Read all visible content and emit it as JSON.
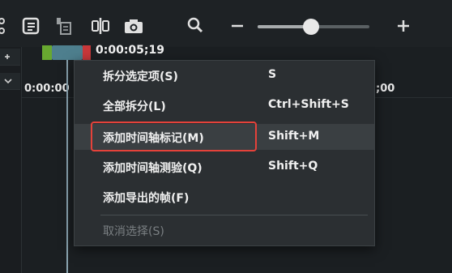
{
  "toolbar": {
    "icons": [
      "scissors-icon",
      "notes-icon",
      "paste-icon",
      "split-icon",
      "camera-icon",
      "search-icon",
      "zoom-out-icon",
      "zoom-slider",
      "zoom-in-icon"
    ],
    "zoom_level": 0.55
  },
  "timeline": {
    "playhead_time": "0:00:05;19",
    "ruler_left": "0:00:00",
    "ruler_right": ";00"
  },
  "context_menu": {
    "items": [
      {
        "label": "拆分选定项(S)",
        "shortcut": "S",
        "enabled": true
      },
      {
        "label": "全部拆分(L)",
        "shortcut": "Ctrl+Shift+S",
        "enabled": true
      },
      {
        "label": "添加时间轴标记(M)",
        "shortcut": "Shift+M",
        "enabled": true,
        "highlighted": true
      },
      {
        "label": "添加时间轴测验(Q)",
        "shortcut": "Shift+Q",
        "enabled": true
      },
      {
        "label": "添加导出的帧(F)",
        "shortcut": "",
        "enabled": true
      },
      {
        "label": "取消选择(S)",
        "shortcut": "",
        "enabled": false
      }
    ]
  },
  "colors": {
    "highlight_box": "#e5423a",
    "playhead": "#4e7f8e",
    "menu_bg": "#2b2f32"
  }
}
